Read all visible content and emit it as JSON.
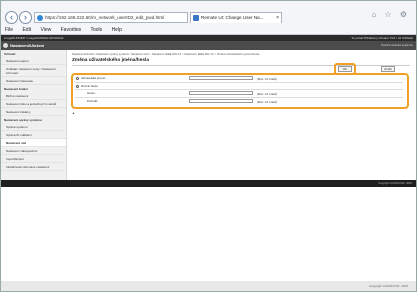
{
  "browser": {
    "url": "https://192.168.222.60/rn_network_userID2_edit_pwd.html",
    "tab_title": "Remote UI: Change User Na...",
    "tab_close": "×",
    "menu": [
      "File",
      "Edit",
      "View",
      "Favorites",
      "Tools",
      "Help"
    ],
    "icons": [
      "home-icon",
      "star-icon",
      "gear-icon"
    ]
  },
  "header": {
    "bar1_left": "imageRUNNER / imageRUNNER ADVANCE",
    "bar1_right": "To portal   Přihlášený uživatel   7/22 / 22   Odhlásit",
    "app_title": "Nastavení/Uložení",
    "app_right": "Úvodní stránka systému"
  },
  "sidebar": {
    "items": [
      {
        "type": "sec",
        "label": "Uživatel"
      },
      {
        "type": "it",
        "label": "Nastavení papíru"
      },
      {
        "type": "it",
        "label": "Ovládání nastavení cesty / Nastavení informací"
      },
      {
        "type": "it",
        "label": "Nastavení časovače"
      },
      {
        "type": "sec",
        "label": "Nastavení funkcí"
      },
      {
        "type": "it",
        "label": "Běžné nastavení"
      },
      {
        "type": "it",
        "label": "Nastavení tisku a jednotlivých modulů"
      },
      {
        "type": "it",
        "label": "Nastavení tiskárny"
      },
      {
        "type": "sec",
        "label": "Nastavení správy systému"
      },
      {
        "type": "it",
        "label": "Správa systému"
      },
      {
        "type": "it",
        "label": "Správa ID oddělení"
      },
      {
        "type": "it",
        "label": "Nastavení sítě",
        "active": true
      },
      {
        "type": "it",
        "label": "Nastavení zabezpečení"
      },
      {
        "type": "it",
        "label": "Import/Export"
      },
      {
        "type": "it",
        "label": "Inicializovat informace nastavení"
      }
    ]
  },
  "main": {
    "breadcrumb": "Nastavení/Uložení: Nastavení správy systému: Nastavení sítě > Nastavení IEEE 802.1X > Nastavení IEEE 802.1X > Změna uživatelského jména/hesla",
    "title": "Změna uživatelského jména/hesla",
    "ok_label": "OK",
    "cancel_label": "Zrušit",
    "username_label": "Uživatelské jméno:",
    "username_hint": "(Max. 24 znaků)",
    "change_password_label": "Změnit heslo",
    "password_label": "Heslo:",
    "password_hint": "(Max. 24 znaků)",
    "confirm_label": "Potvrdit:",
    "confirm_hint": "(Max. 24 znaků)",
    "back_label": "▲"
  },
  "footer": {
    "copyright": "Copyright CANON INC. 2015"
  }
}
